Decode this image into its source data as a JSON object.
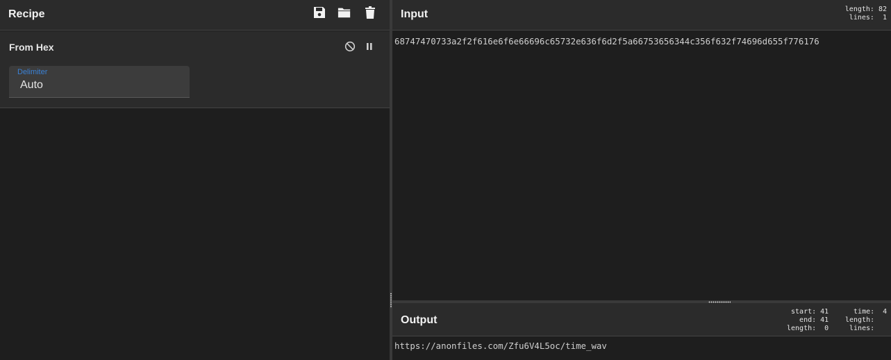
{
  "recipe": {
    "title": "Recipe",
    "icons": [
      "save-icon",
      "folder-icon",
      "trash-icon"
    ],
    "operation": {
      "name": "From Hex",
      "icons": [
        "disable-icon",
        "pause-icon"
      ],
      "delimiter_label": "Delimiter",
      "delimiter_value": "Auto"
    }
  },
  "input": {
    "title": "Input",
    "stats": "length: 82\n lines:  1",
    "text": "68747470733a2f2f616e6f6e66696c65732e636f6d2f5a66753656344c356f632f74696d655f776176"
  },
  "output": {
    "title": "Output",
    "stats_a": " start: 41\n   end: 41\nlength:  0",
    "stats_b": "  time:  4\nlength: \n lines: ",
    "text": "https://anonfiles.com/Zfu6V4L5oc/time_wav"
  },
  "colors": {
    "background": "#1e1e1e",
    "panel": "#2b2b2b",
    "accent": "#3b82d6"
  }
}
